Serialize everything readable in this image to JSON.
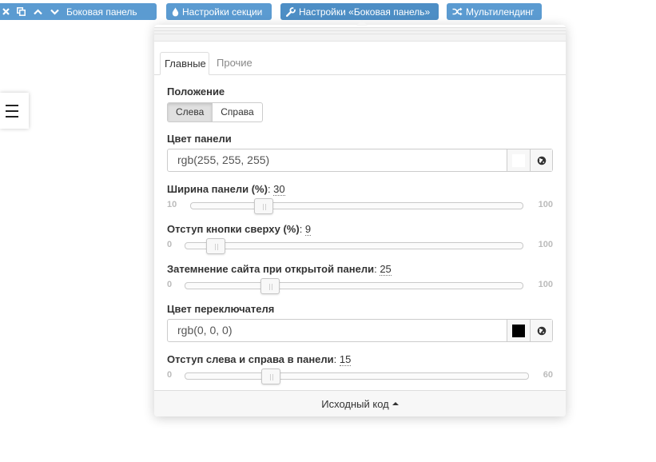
{
  "toolbar": {
    "block_label": "Боковая панель",
    "section_settings": "Настройки секции",
    "block_settings": "Настройки «Боковая панель»",
    "multilanding": "Мультилендинг",
    "accent_color": "#5b9bd1"
  },
  "panel": {
    "tabs": [
      "Главные",
      "Прочие"
    ],
    "position": {
      "label": "Положение",
      "options": [
        "Слева",
        "Справа"
      ],
      "selected": "Слева"
    },
    "panel_color": {
      "label": "Цвет панели",
      "value": "rgb(255, 255, 255)",
      "swatch": "#ffffff"
    },
    "panel_width": {
      "label": "Ширина панели (%)",
      "value": "30",
      "min": "10",
      "max": "100"
    },
    "button_offset": {
      "label": "Отступ кнопки сверху (%)",
      "value": "9",
      "min": "0",
      "max": "100"
    },
    "site_dimming": {
      "label": "Затемнение сайта при открытой панели",
      "value": "25",
      "min": "0",
      "max": "100"
    },
    "toggle_color": {
      "label": "Цвет переключателя",
      "value": "rgb(0, 0, 0)",
      "swatch": "#000000"
    },
    "side_padding": {
      "label": "Отступ слева и справа в панели",
      "value": "15",
      "min": "0",
      "max": "60"
    },
    "footer": "Исходный код"
  }
}
